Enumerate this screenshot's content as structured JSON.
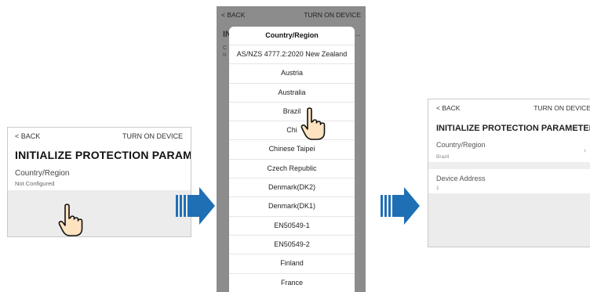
{
  "panel1": {
    "back": "< BACK",
    "turn_on": "TURN ON DEVICE",
    "title": "INITIALIZE PROTECTION PARAM…",
    "country_label": "Country/Region",
    "country_value": "Not Configured"
  },
  "panel2": {
    "back": "< BACK",
    "turn_on": "TURN ON DEVICE",
    "bg_title": "IN",
    "bg_dots": "…",
    "bg_small1": "C",
    "bg_small2": "N",
    "modal_title": "Country/Region",
    "options": [
      "AS/NZS 4777.2:2020 New Zealand",
      "Austria",
      "Australia",
      "Brazil",
      "Chi",
      "Chinese Taipei",
      "Czech Republic",
      "Denmark(DK2)",
      "Denmark(DK1)",
      "EN50549-1",
      "EN50549-2",
      "Finland",
      "France"
    ]
  },
  "panel3": {
    "back": "< BACK",
    "turn_on": "TURN ON DEVICE",
    "title": "INITIALIZE PROTECTION PARAMETER",
    "country_label": "Country/Region",
    "country_value": "Brazil",
    "address_label": "Device Address",
    "address_value": "1"
  },
  "colors": {
    "arrow_blue": "#1f6fb5",
    "hand_fill": "#fde3c0",
    "overlay_grey": "#8c8c8c"
  }
}
